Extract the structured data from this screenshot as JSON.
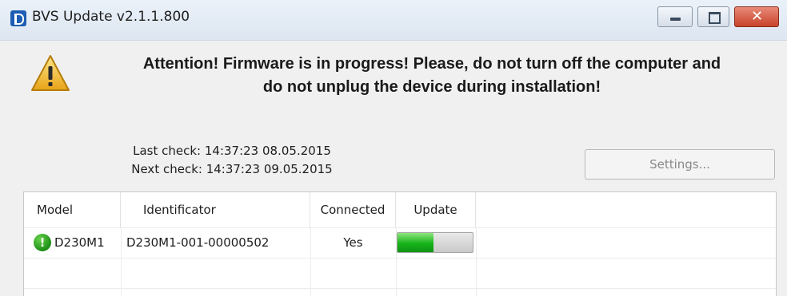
{
  "window": {
    "title": "BVS Update v2.1.1.800",
    "icons": {
      "app": "app-logo-icon",
      "minimize": "minimize-icon",
      "maximize": "maximize-icon",
      "close": "close-icon"
    },
    "close_glyph": "✕"
  },
  "warning": {
    "icon": "warning-icon",
    "line1": "Attention! Firmware is in progress!  Please, do not turn off the computer and",
    "line2": "do not unplug the device during installation!"
  },
  "checks": {
    "last_check": "Last check: 14:37:23 08.05.2015",
    "next_check": "Next check: 14:37:23 09.05.2015"
  },
  "settings_button": {
    "label": "Settings...",
    "enabled": false
  },
  "table": {
    "columns": [
      "Model",
      "Identificator",
      "Connected",
      "Update"
    ],
    "rows": [
      {
        "status_icon": "alert-status-icon",
        "status_glyph": "!",
        "model": "D230M1",
        "identificator": "D230M1-001-00000502",
        "connected": "Yes",
        "update_progress_percent": 48
      }
    ]
  },
  "colors": {
    "status_green": "#1e8f17",
    "progress_green": "#16b31b",
    "warning_yellow": "#f2c230"
  }
}
